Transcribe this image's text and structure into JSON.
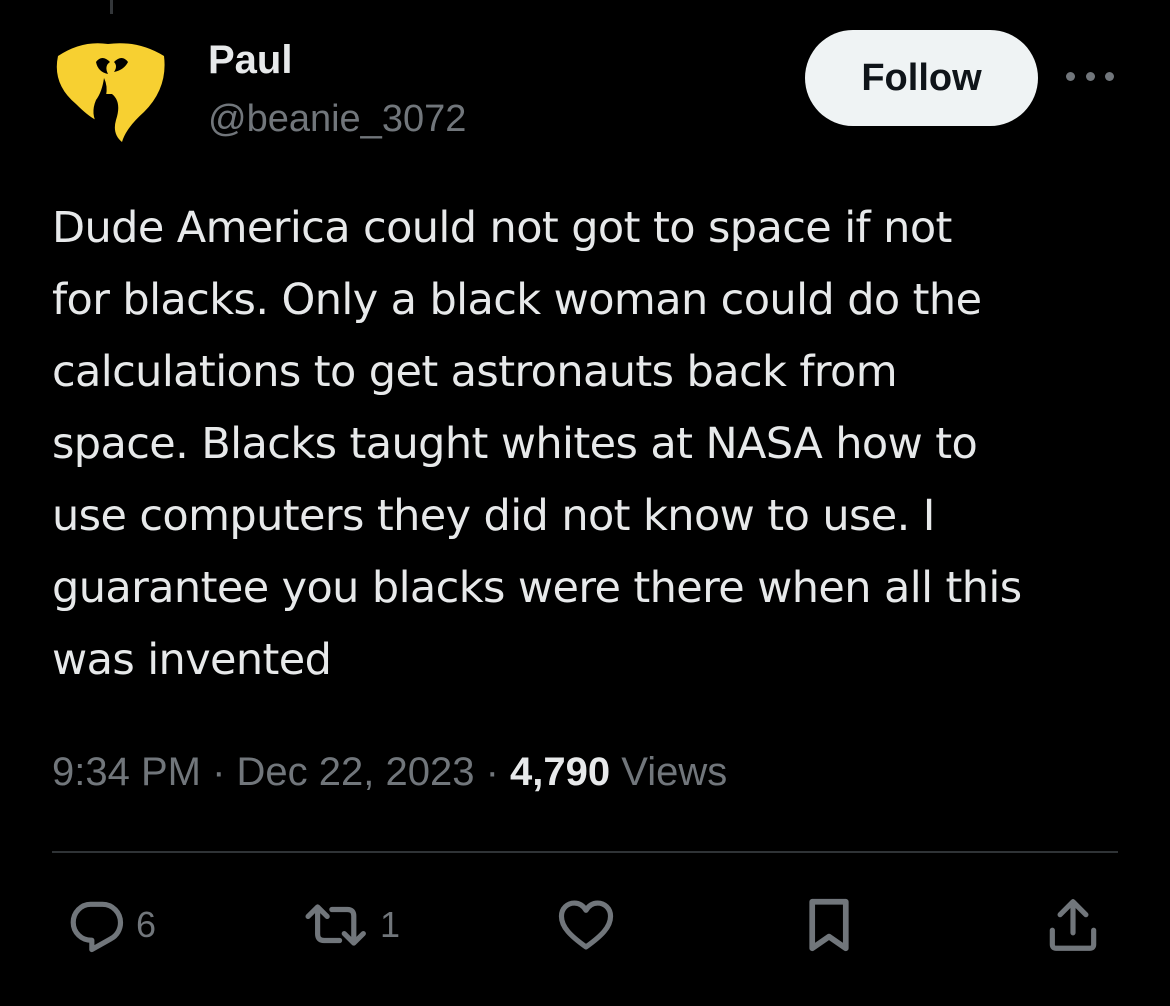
{
  "author": {
    "display_name": "Paul",
    "handle": "@beanie_3072",
    "avatar_icon": "yellow-w-logo-icon",
    "avatar_color": "#f7d031"
  },
  "follow_button": {
    "label": "Follow",
    "background": "#eff3f4"
  },
  "more_button": {
    "icon": "more-horizontal-icon"
  },
  "tweet": {
    "text": "Dude America could not got to space if not\nfor blacks. Only a black woman could do the\ncalculations to get astronauts back from\nspace. Blacks taught whites at NASA how to\nuse computers they did not know to use. I\nguarantee you blacks were there when all this\nwas invented"
  },
  "meta": {
    "time": "9:34 PM",
    "separator": " · ",
    "date": "Dec 22, 2023",
    "views_count": "4,790",
    "views_label": " Views"
  },
  "actions": {
    "reply": {
      "icon": "reply-icon",
      "count": "6"
    },
    "retweet": {
      "icon": "retweet-icon",
      "count": "1"
    },
    "like": {
      "icon": "heart-icon"
    },
    "bookmark": {
      "icon": "bookmark-icon"
    },
    "share": {
      "icon": "share-icon"
    }
  },
  "colors": {
    "background": "#000000",
    "text_primary": "#e7e9ea",
    "text_secondary": "#71767b",
    "divider": "#2f3336"
  }
}
